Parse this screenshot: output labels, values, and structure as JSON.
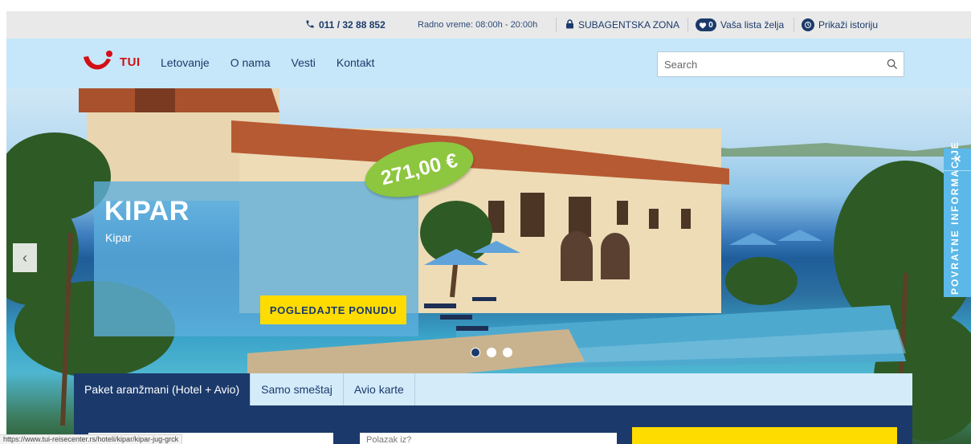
{
  "topbar": {
    "phone": "011 / 32 88 852",
    "hours": "Radno vreme: 08:00h - 20:00h",
    "agent_zone": "SUBAGENTSKA ZONA",
    "wishlist_count": "0",
    "wishlist_label": "Vaša lista želja",
    "history_label": "Prikaži istoriju"
  },
  "header": {
    "logo_text": "TUI",
    "nav": [
      "Letovanje",
      "O nama",
      "Vesti",
      "Kontakt"
    ],
    "search_placeholder": "Search"
  },
  "hero": {
    "title": "KIPAR",
    "subtitle": "Kipar",
    "price": "271,00 €",
    "cta_label": "POGLEDAJTE PONUDU",
    "slide_count": 3,
    "active_slide": 1
  },
  "feedback": {
    "close": "×",
    "label": "POVRATNE INFORMACIJE"
  },
  "booking": {
    "tabs": [
      "Paket aranžmani (Hotel + Avio)",
      "Samo smeštaj",
      "Avio karte"
    ],
    "active_tab": 0,
    "departure_placeholder": "Polazak iz?"
  },
  "status_url": "https://www.tui-reisecenter.rs/hoteli/kipar/kipar-jug-grck",
  "colors": {
    "brand_navy": "#1b3a6b",
    "tui_red": "#d40e14",
    "header_bg": "#c5e7f9",
    "cta_yellow": "#ffdc00",
    "price_green": "#8dc63f",
    "feedback_blue": "#5cb8e8"
  },
  "icons": {
    "phone": "phone-icon",
    "lock": "lock-icon",
    "heart": "heart-icon",
    "clock": "clock-icon",
    "search": "search-icon",
    "prev": "chevron-left-icon",
    "close": "close-icon"
  }
}
